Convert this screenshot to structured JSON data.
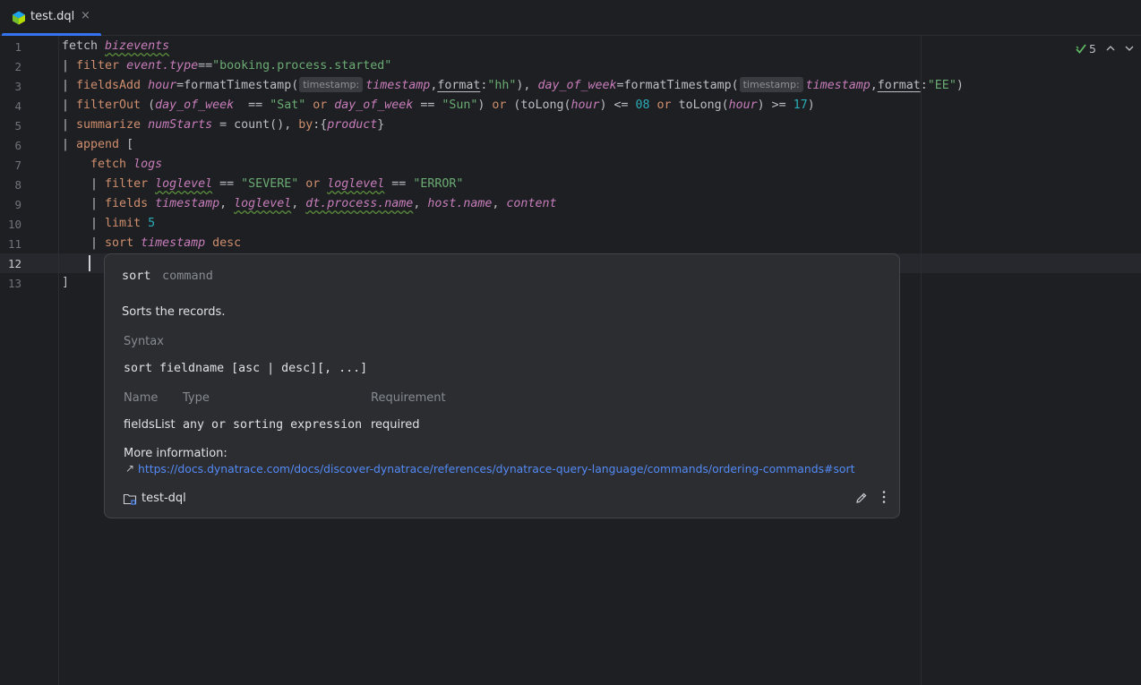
{
  "tab": {
    "title": "test.dql",
    "close": "×"
  },
  "status": {
    "count": "5"
  },
  "editor": {
    "line_numbers": [
      "1",
      "2",
      "3",
      "4",
      "5",
      "6",
      "7",
      "8",
      "9",
      "10",
      "11",
      "12",
      "13"
    ],
    "hints": {
      "timestamp": "timestamp:"
    }
  },
  "popup": {
    "command": "sort",
    "kind": "command",
    "description": "Sorts the records.",
    "syntax_heading": "Syntax",
    "syntax": "sort fieldname [asc | desc][, ...]",
    "table": {
      "headers": [
        "Name",
        "Type",
        "Requirement"
      ],
      "row": [
        "fieldsList",
        "any or sorting expression",
        "required"
      ]
    },
    "more_info": "More information:",
    "link": "https://docs.dynatrace.com/docs/discover-dynatrace/references/dynatrace-query-language/commands/ordering-commands#sort",
    "project": "test-dql"
  }
}
